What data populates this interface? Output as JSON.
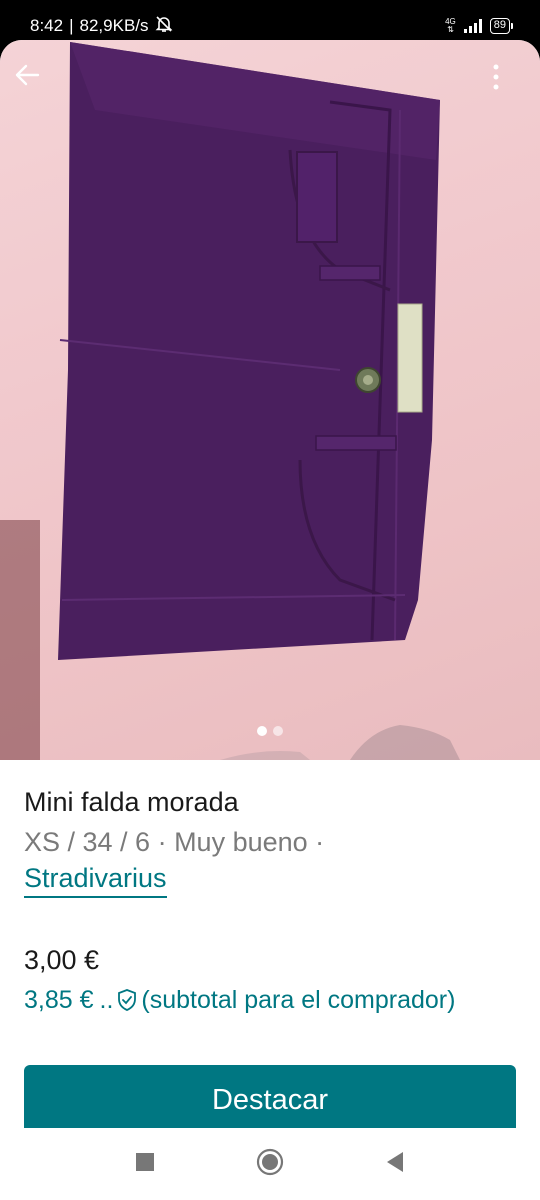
{
  "status": {
    "time": "8:42",
    "speed": "82,9KB/s",
    "network": "4G",
    "battery": "89"
  },
  "icons": {
    "back": "arrow-left-icon",
    "more": "more-vertical-icon",
    "mute": "bell-off-icon",
    "shield": "shield-check-icon",
    "nav_recent": "square-icon",
    "nav_home": "circle-icon",
    "nav_back": "triangle-left-icon"
  },
  "carousel": {
    "count": 2,
    "active": 1
  },
  "item": {
    "title": "Mini falda morada",
    "meta": "XS / 34 / 6 · Muy bueno ·",
    "brand": "Stradivarius",
    "price": "3,00 €",
    "buyer_price": "3,85 €",
    "buyer_ellipsis": "..",
    "buyer_note": "(subtotal para el comprador)"
  },
  "actions": {
    "highlight_label": "Destacar"
  },
  "colors": {
    "accent": "#007782",
    "text": "#1a1a1a",
    "muted": "#7a7a7a"
  }
}
